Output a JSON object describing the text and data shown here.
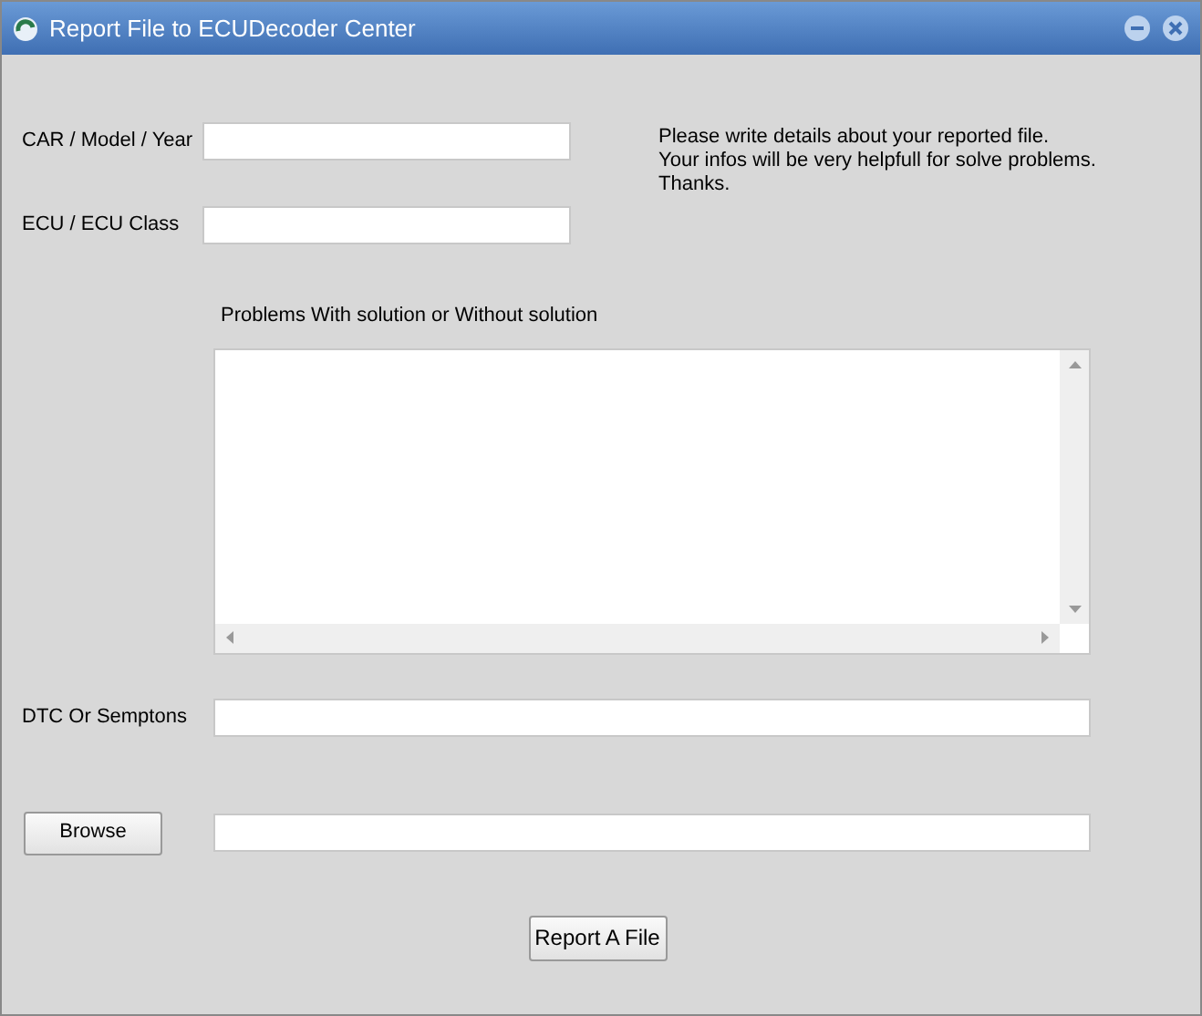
{
  "window": {
    "title": "Report File to ECUDecoder Center"
  },
  "fields": [
    {
      "label": "CAR / Model / Year"
    },
    {
      "label": "ECU / ECU Class"
    }
  ],
  "info_lines": [
    "Please write details about your reported file.",
    "Your infos will be very helpfull for solve problems.",
    "Thanks."
  ],
  "problems_label": "Problems With solution or Without solution",
  "dtc_label": "DTC Or Semptons",
  "browse_button": "Browse",
  "submit_button": "Report A File"
}
